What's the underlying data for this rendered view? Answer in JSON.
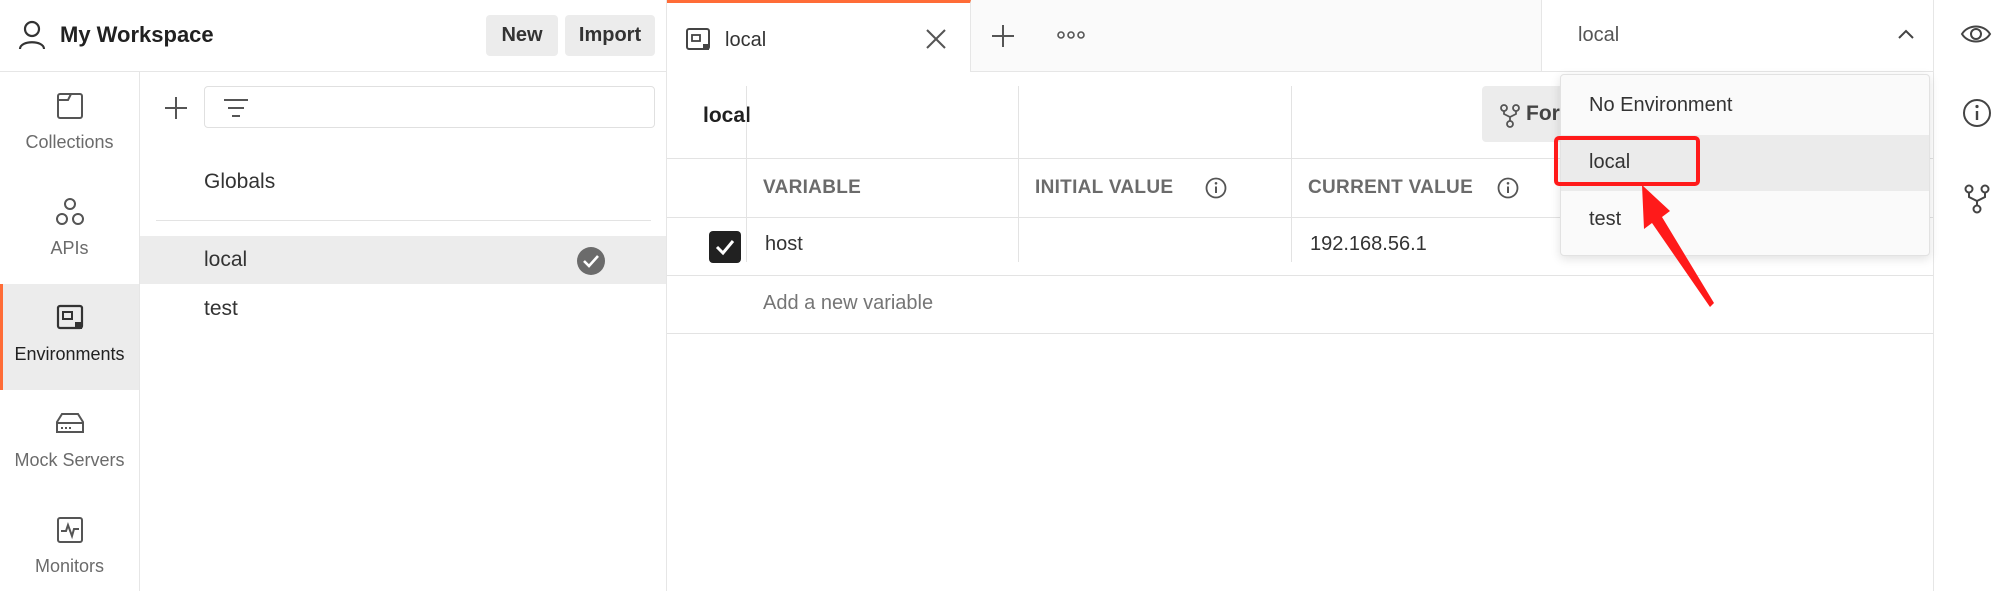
{
  "workspace": {
    "title": "My Workspace",
    "new_label": "New",
    "import_label": "Import"
  },
  "nav": {
    "items": [
      {
        "label": "Collections",
        "icon": "collections-icon"
      },
      {
        "label": "APIs",
        "icon": "apis-icon"
      },
      {
        "label": "Environments",
        "icon": "environments-icon",
        "active": true
      },
      {
        "label": "Mock Servers",
        "icon": "mock-servers-icon"
      },
      {
        "label": "Monitors",
        "icon": "monitors-icon"
      }
    ]
  },
  "env_list": {
    "filter_placeholder": "",
    "globals_label": "Globals",
    "environments": [
      {
        "name": "local",
        "selected": true,
        "active": true
      },
      {
        "name": "test",
        "selected": false,
        "active": false
      }
    ]
  },
  "tabs": [
    {
      "label": "local",
      "active": true
    }
  ],
  "env_selector": {
    "value": "local",
    "options": [
      "No Environment",
      "local",
      "test"
    ],
    "hovered": "local"
  },
  "editor": {
    "env_name": "local",
    "fork_label": "For",
    "columns": [
      "VARIABLE",
      "INITIAL VALUE",
      "CURRENT VALUE"
    ],
    "rows": [
      {
        "enabled": true,
        "variable": "host",
        "initial_value": "",
        "current_value": "192.168.56.1"
      }
    ],
    "new_variable_placeholder": "Add a new variable"
  },
  "colors": {
    "accent": "#ff6c37",
    "annotation": "#ff1a1a",
    "selected_bg": "#ececec"
  }
}
